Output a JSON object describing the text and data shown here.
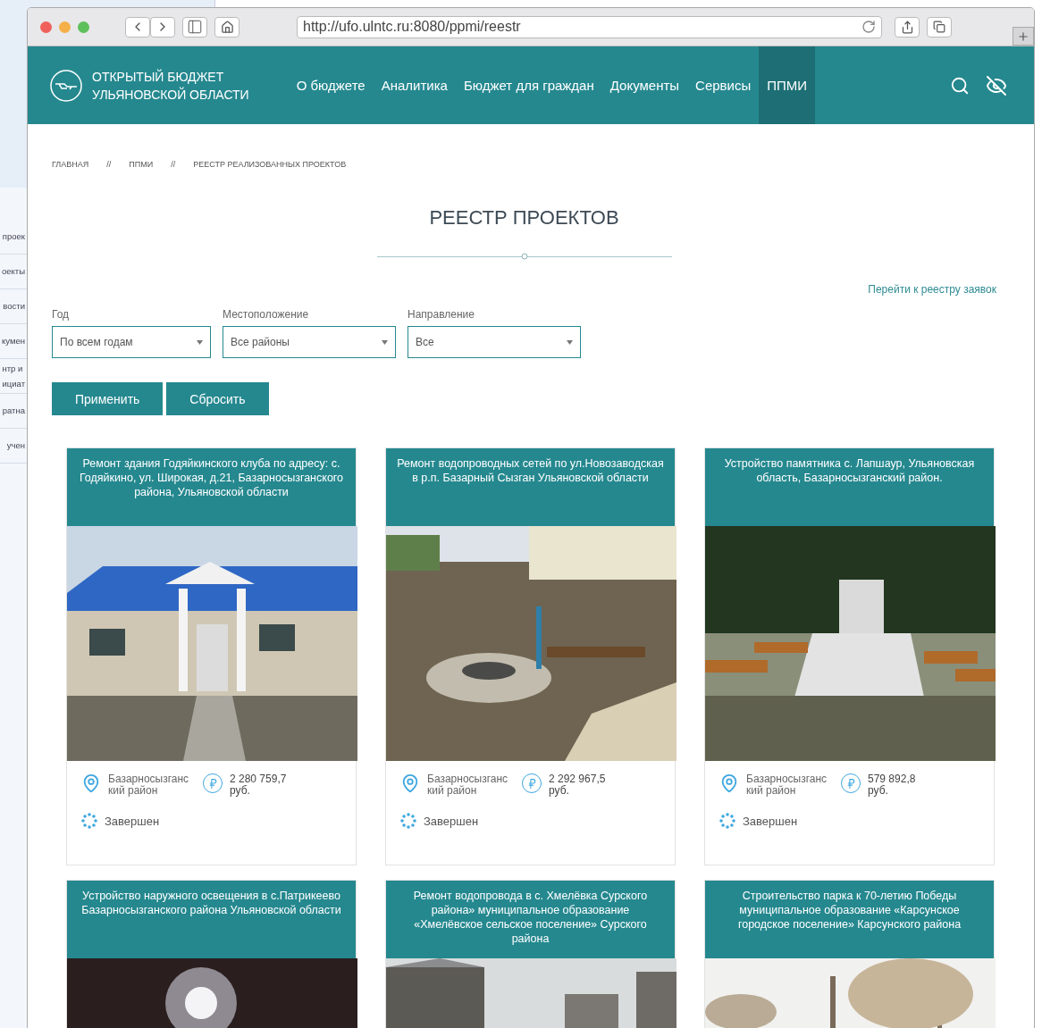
{
  "background_window": {
    "items": [
      "проек",
      "оекты",
      "вости",
      "кумен",
      "нтр и\nициат",
      "ратна",
      "учен"
    ]
  },
  "browser": {
    "url": "http://ufo.ulntc.ru:8080/ppmi/reestr"
  },
  "site": {
    "logo_lines": [
      "ОТКРЫТЫЙ БЮДЖЕТ",
      "УЛЬЯНОВСКОЙ ОБЛАСТИ"
    ],
    "nav": [
      {
        "label": "О бюджете",
        "selected": false
      },
      {
        "label": "Аналитика",
        "selected": false
      },
      {
        "label": "Бюджет для граждан",
        "selected": false
      },
      {
        "label": "Документы",
        "selected": false
      },
      {
        "label": "Сервисы",
        "selected": false
      },
      {
        "label": "ППМИ",
        "selected": true
      }
    ]
  },
  "breadcrumbs": [
    "ГЛАВНАЯ",
    "ППМИ",
    "РЕЕСТР РЕАЛИЗОВАННЫХ ПРОЕКТОВ"
  ],
  "breadcrumb_separator": "//",
  "page_title": "РЕЕСТР ПРОЕКТОВ",
  "registry_link": "Перейти к реестру заявок",
  "filters": [
    {
      "label": "Год",
      "value": "По всем годам"
    },
    {
      "label": "Местоположение",
      "value": "Все районы"
    },
    {
      "label": "Направление",
      "value": "Все"
    }
  ],
  "buttons": [
    "Применить",
    "Сбросить"
  ],
  "cards": [
    {
      "title": "Ремонт здания Годяйкинского клуба по адресу: с. Годяйкино, ул. Широкая, д.21, Базарносызганского района, Ульяновской области",
      "location": "Базарносызганский район",
      "amount": "2 280 759,7",
      "currency": "руб.",
      "status": "Завершен"
    },
    {
      "title": "Ремонт водопроводных сетей по ул.Новозаводская в р.п. Базарный Сызган Ульяновской области",
      "location": "Базарносызганский район",
      "amount": "2 292 967,5",
      "currency": "руб.",
      "status": "Завершен"
    },
    {
      "title": "Устройство памятника с. Лапшаур, Ульяновская область, Базарносызганский район.",
      "location": "Базарносызганский район",
      "amount": "579 892,8",
      "currency": "руб.",
      "status": "Завершен"
    },
    {
      "title": "Устройство наружного освещения в с.Патрикеево Базарносызганского района Ульяновской области"
    },
    {
      "title": "Ремонт водопровода в с. Хмелёвка Сурского района» муниципальное образование «Хмелёвское сельское поселение» Сурского района"
    },
    {
      "title": "Строительство парка к 70-летию Победы муниципальное образование «Карсунское городское поселение» Карсунского района"
    }
  ]
}
